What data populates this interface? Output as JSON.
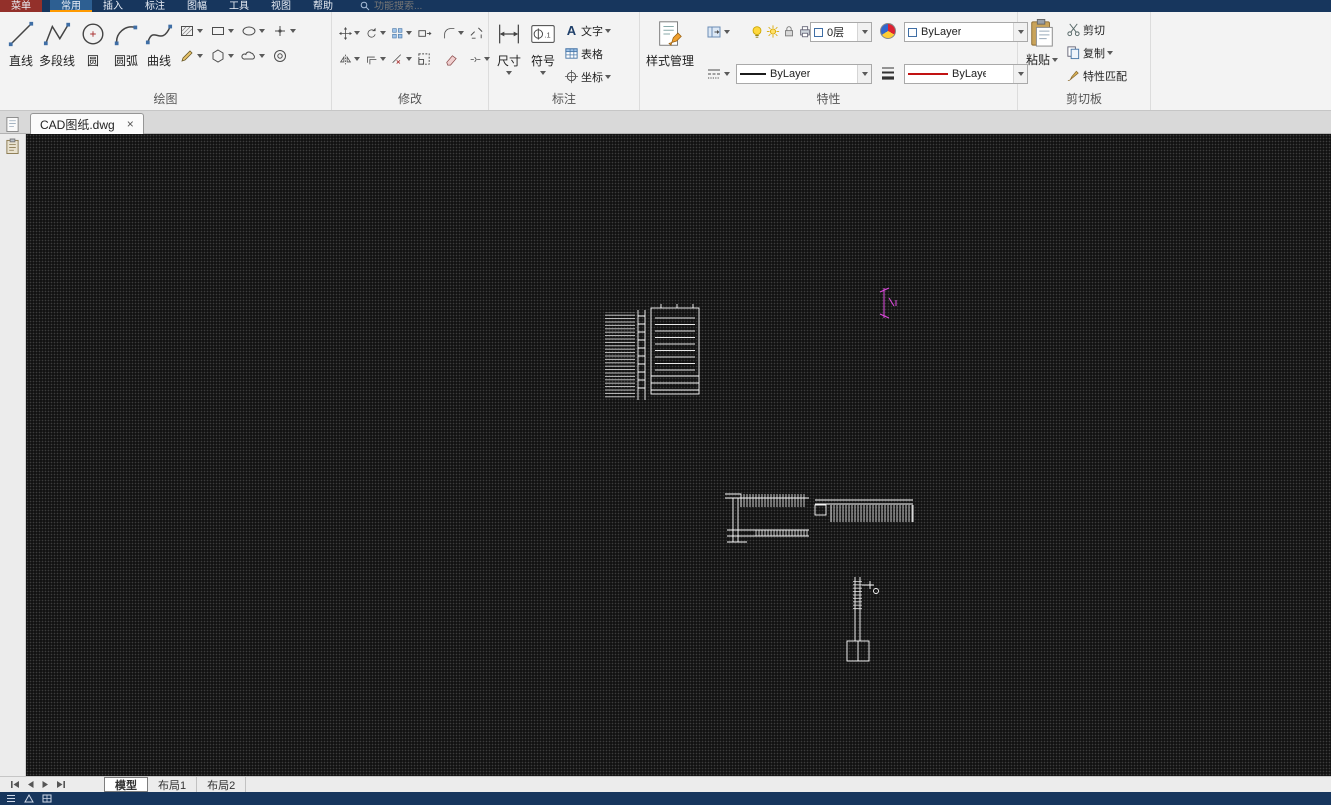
{
  "menu": {
    "root": "菜单",
    "tabs": [
      "常用",
      "插入",
      "标注",
      "图幅",
      "工具",
      "视图",
      "帮助"
    ],
    "active_tab": "常用",
    "search_placeholder": "功能搜索..."
  },
  "ribbon": {
    "groups": {
      "draw": {
        "label": "绘图",
        "tools": {
          "line": "直线",
          "polyline": "多段线",
          "circle": "圆",
          "arc": "圆弧",
          "spline": "曲线"
        }
      },
      "modify": {
        "label": "修改"
      },
      "annotate": {
        "label": "标注",
        "tools": {
          "dimension": "尺寸",
          "symbol": "符号",
          "text": "文字",
          "table": "表格",
          "coordinate": "坐标"
        },
        "text_glyph": "A",
        "symbol_badge": ".1"
      },
      "properties": {
        "label": "特性",
        "style_manager": "样式管理",
        "layer": "0层",
        "layer_color": "ByLayer",
        "linetype": "ByLayer",
        "lineweight": "ByLayer"
      },
      "clipboard": {
        "label": "剪切板",
        "paste": "粘贴",
        "cut": "剪切",
        "copy": "复制",
        "match_properties": "特性匹配"
      }
    }
  },
  "doc": {
    "tab": "CAD图纸.dwg",
    "close": "×"
  },
  "layouts": {
    "model": "模型",
    "layout1": "布局1",
    "layout2": "布局2"
  },
  "colors": {
    "titlebar": "#17365d",
    "accent_orange": "#ff9a00",
    "menu_root_red": "#93302a",
    "canvas_bg": "#121212",
    "drawing_stroke": "#ffffff",
    "highlight_magenta": "#e14ae1",
    "lineweight_red": "#c11212"
  }
}
